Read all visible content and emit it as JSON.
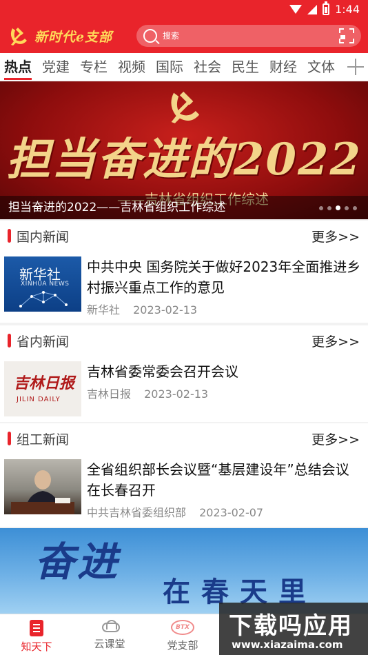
{
  "status_bar": {
    "time": "1:44"
  },
  "header": {
    "app_title": "新时代e支部",
    "search_placeholder": "搜索",
    "colors": {
      "brand": "#e9242b",
      "logo_text": "#ffd95a"
    }
  },
  "tabs": [
    {
      "label": "热点",
      "active": true
    },
    {
      "label": "党建"
    },
    {
      "label": "专栏"
    },
    {
      "label": "视频"
    },
    {
      "label": "国际"
    },
    {
      "label": "社会"
    },
    {
      "label": "民生"
    },
    {
      "label": "财经"
    },
    {
      "label": "文体"
    }
  ],
  "banner": {
    "headline": "担当奋进的2022",
    "subline": "——吉林省组织工作综述",
    "caption": "担当奋进的2022——吉林省组织工作综述",
    "slide_count": 5,
    "active_slide": 3
  },
  "sections": [
    {
      "title": "国内新闻",
      "more": "更多>>",
      "item": {
        "thumb_text_cn": "新华社",
        "thumb_text_en": "XINHUA NEWS",
        "title": "中共中央 国务院关于做好2023年全面推进乡村振兴重点工作的意见",
        "source": "新华社",
        "date": "2023-02-13"
      }
    },
    {
      "title": "省内新闻",
      "more": "更多>>",
      "item": {
        "thumb_text_cn": "吉林日报",
        "thumb_text_en": "JILIN DAILY",
        "title": "吉林省委常委会召开会议",
        "source": "吉林日报",
        "date": "2023-02-13"
      }
    },
    {
      "title": "组工新闻",
      "more": "更多>>",
      "item": {
        "title": "全省组织部长会议暨“基层建设年”总结会议在长春召开",
        "source": "中共吉林省委组织部",
        "date": "2023-02-07"
      }
    }
  ],
  "promo": {
    "big": "奋进",
    "small": "在春天里"
  },
  "bottom_nav": [
    {
      "label": "知天下",
      "icon": "document-icon",
      "active": true
    },
    {
      "label": "云课堂",
      "icon": "cloud-icon"
    },
    {
      "label": "党支部",
      "icon": "btx-icon",
      "icon_text": "BTX"
    }
  ],
  "watermark": {
    "line1": "下载吗应用",
    "line2": "www.xiazaima.com"
  }
}
